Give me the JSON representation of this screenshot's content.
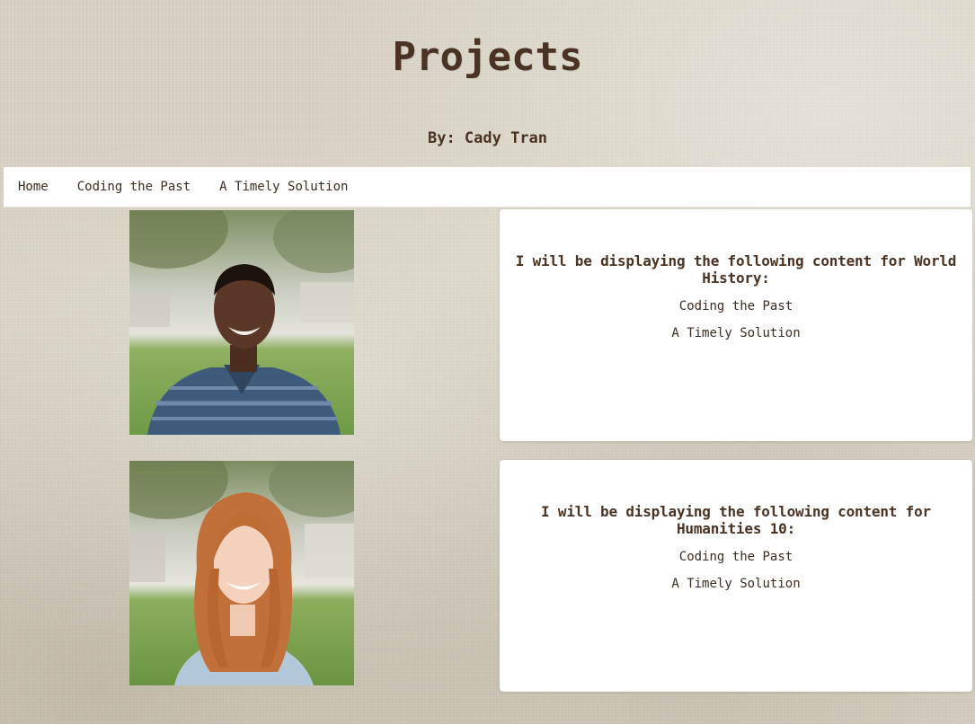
{
  "header": {
    "title": "Projects",
    "byline": "By: Cady Tran"
  },
  "nav": {
    "items": [
      {
        "label": "Home"
      },
      {
        "label": "Coding the Past"
      },
      {
        "label": "A Timely Solution"
      }
    ]
  },
  "sections": [
    {
      "photo": "portrait-man",
      "heading": "I will be displaying the following content for World History:",
      "links": [
        "Coding the Past",
        "A Timely Solution"
      ]
    },
    {
      "photo": "portrait-woman",
      "heading": "I will be displaying the following content for Humanities 10:",
      "links": [
        "Coding the Past",
        "A Timely Solution"
      ]
    }
  ],
  "colors": {
    "text": "#4a3322",
    "background": "#d8d3c4",
    "panel": "#ffffff"
  }
}
